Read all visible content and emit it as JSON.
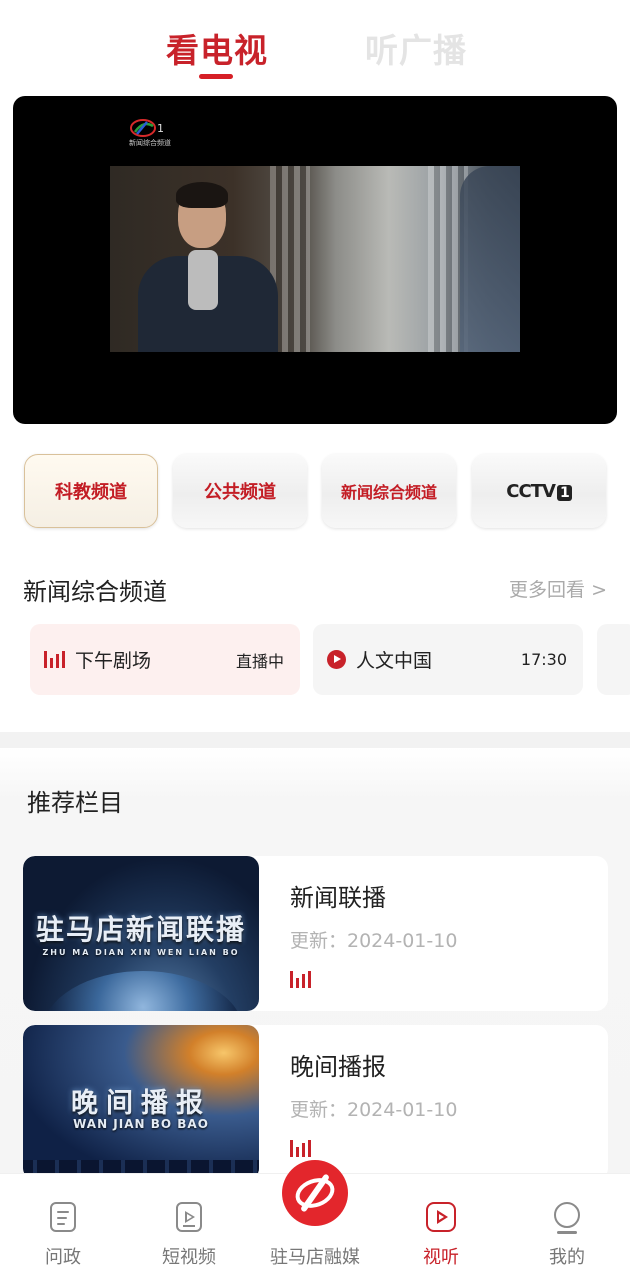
{
  "top_tabs": {
    "watch_tv": "看电视",
    "listen_radio": "听广播"
  },
  "player": {
    "channel_logo_num": "1",
    "channel_logo_text": "新闻综合频道"
  },
  "channels": [
    {
      "label": "科教频道",
      "selected": true
    },
    {
      "label": "公共频道",
      "selected": false
    },
    {
      "label": "新闻综合频道",
      "selected": false
    },
    {
      "label": "CCTV",
      "num": "1",
      "selected": false
    }
  ],
  "channel_section": {
    "title": "新闻综合频道",
    "more": "更多回看 >"
  },
  "schedule": [
    {
      "name": "下午剧场",
      "status": "直播中",
      "icon": "playing-bars-icon"
    },
    {
      "name": "人文中国",
      "status": "17:30",
      "icon": "play-circle-icon"
    }
  ],
  "recommend": {
    "title": "推荐栏目",
    "items": [
      {
        "title": "新闻联播",
        "date": "更新：2024-01-10",
        "thumb_title": "驻马店新闻联播",
        "thumb_sub": "ZHU MA DIAN XIN WEN LIAN BO"
      },
      {
        "title": "晚间播报",
        "date": "更新：2024-01-10",
        "thumb_title": "晚间播报",
        "thumb_sub": "WAN JIAN BO BAO"
      }
    ]
  },
  "bottom_nav": [
    {
      "label": "问政",
      "icon": "document-icon",
      "active": false
    },
    {
      "label": "短视频",
      "icon": "short-video-icon",
      "active": false
    },
    {
      "label": "驻马店融媒",
      "icon": "zmd-logo-icon",
      "active": false
    },
    {
      "label": "视听",
      "icon": "play-square-icon",
      "active": true
    },
    {
      "label": "我的",
      "icon": "user-icon",
      "active": false
    }
  ],
  "colors": {
    "accent": "#c8222a",
    "muted": "#aaaaaa",
    "inactive_tab": "#e4e4e4"
  }
}
